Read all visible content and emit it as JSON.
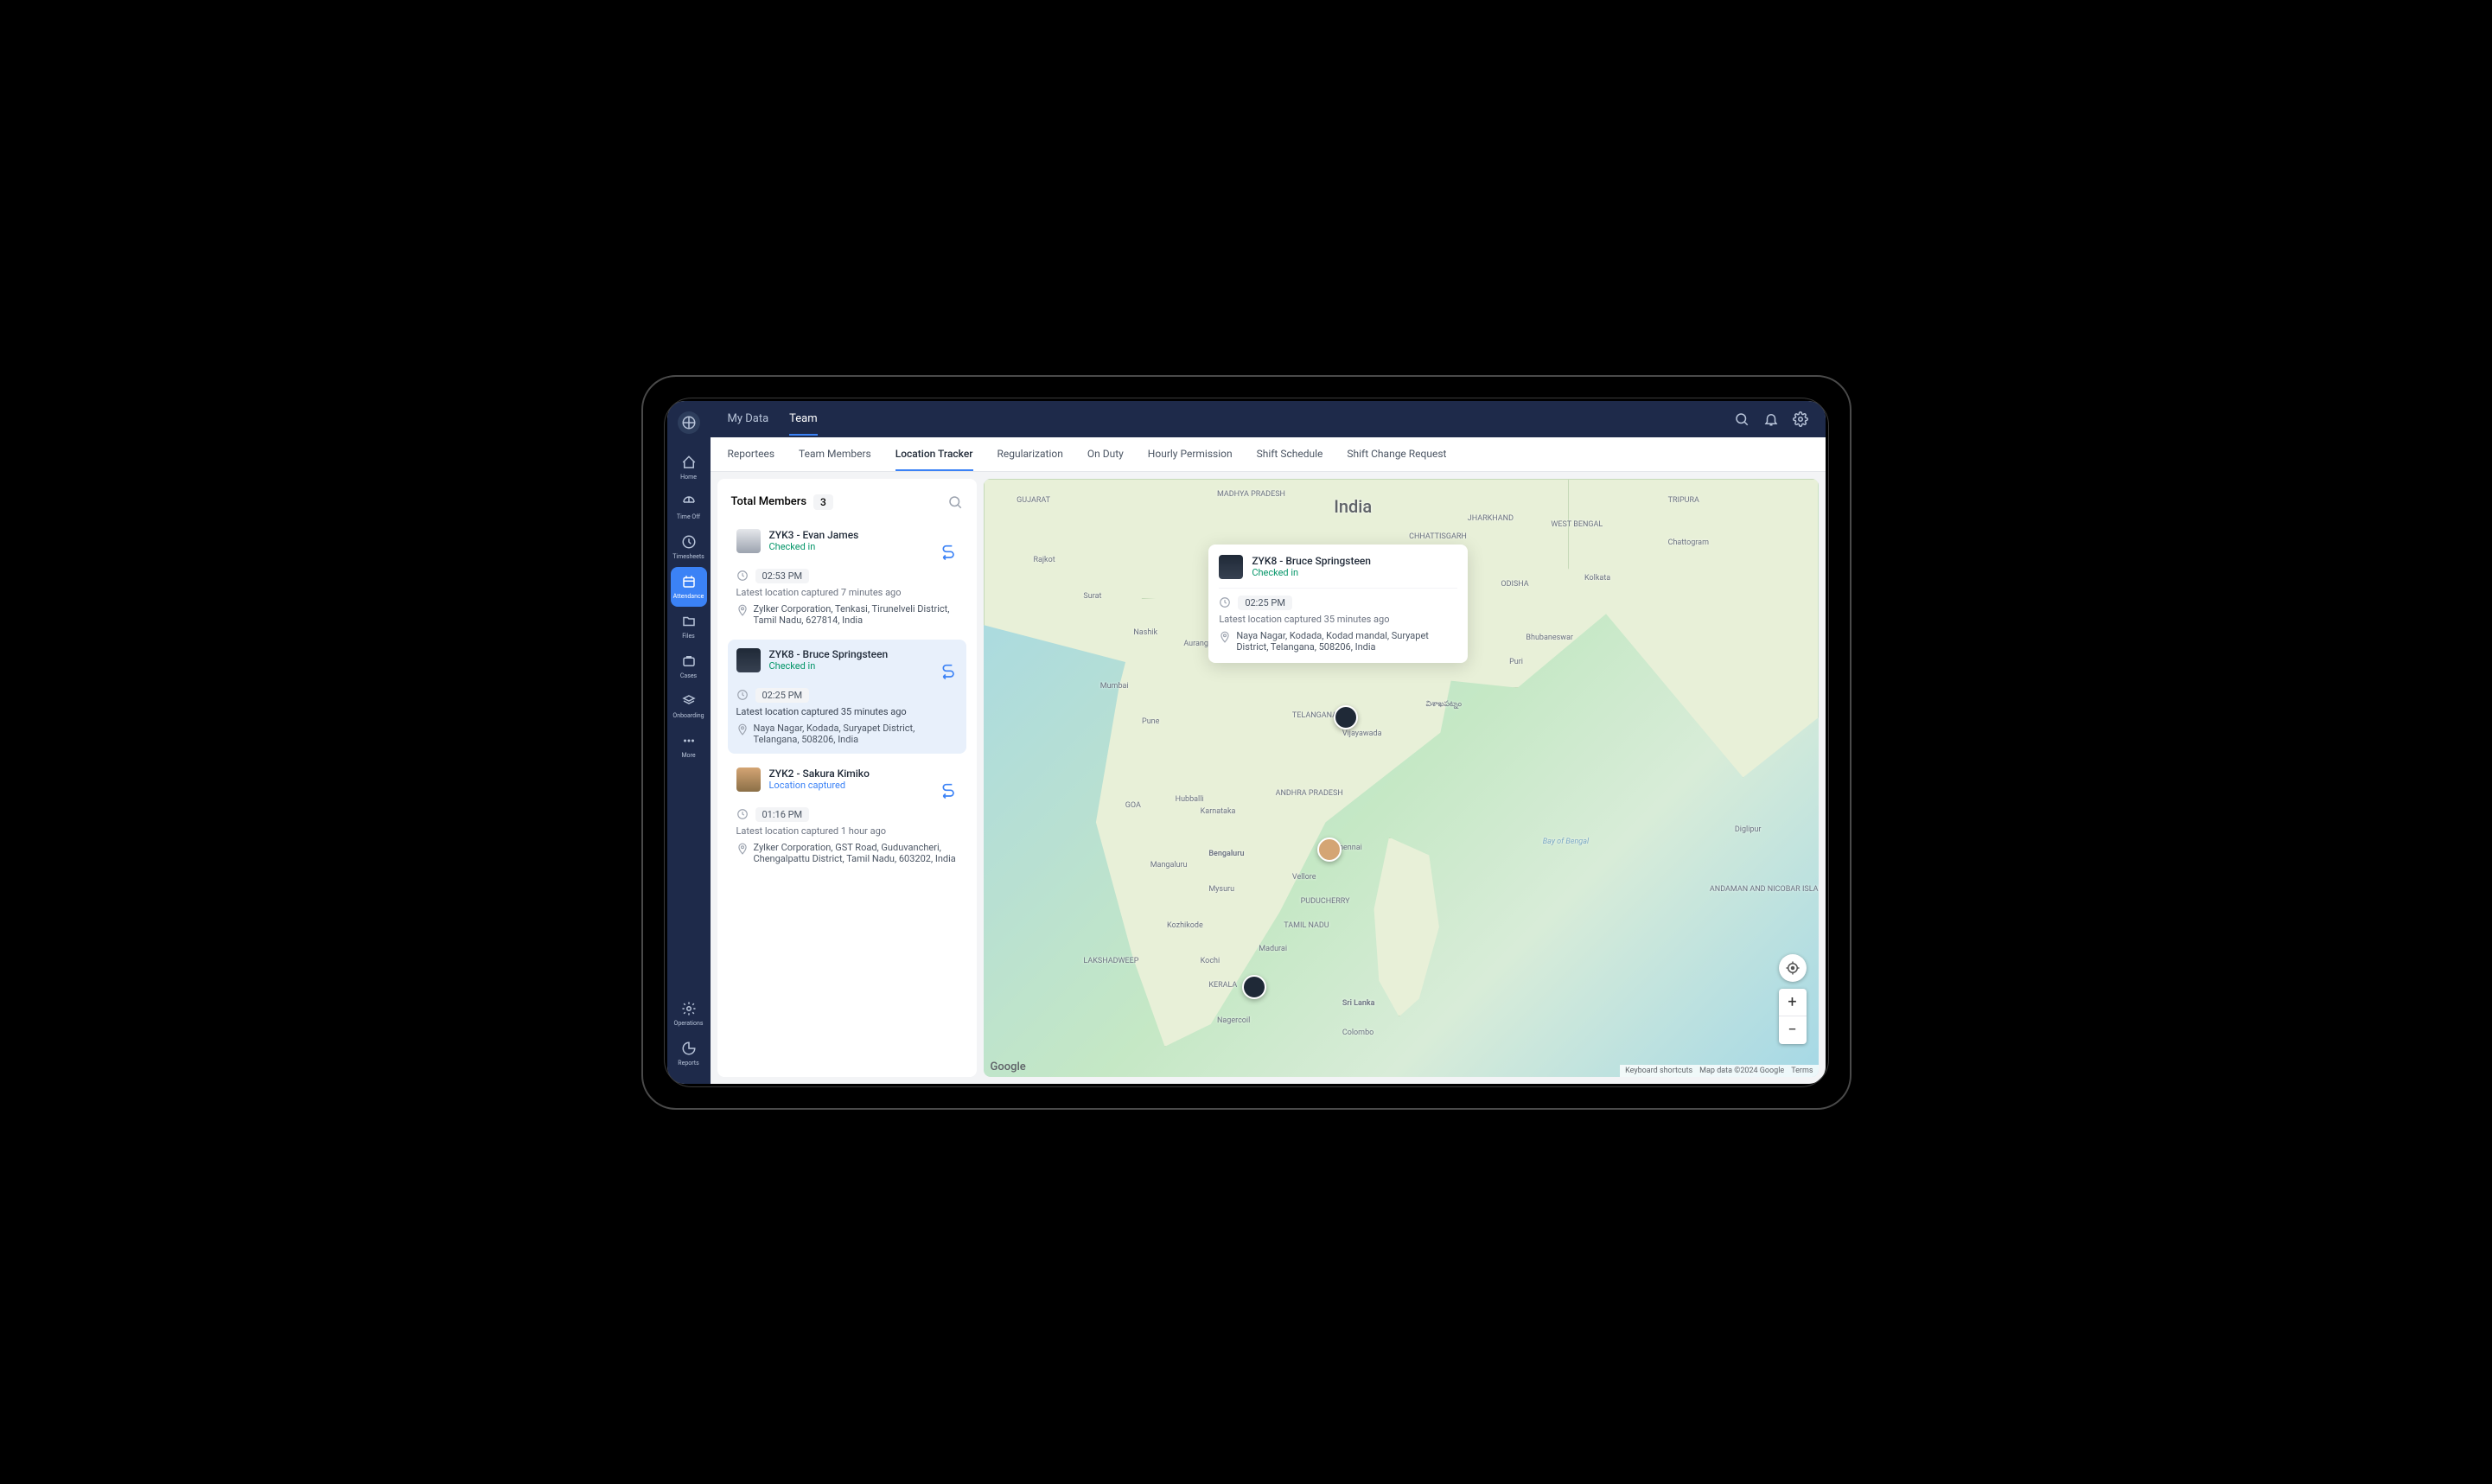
{
  "sidebar": {
    "items": [
      {
        "label": "Home"
      },
      {
        "label": "Time Off"
      },
      {
        "label": "Timesheets"
      },
      {
        "label": "Attendance"
      },
      {
        "label": "Files"
      },
      {
        "label": "Cases"
      },
      {
        "label": "Onboarding"
      },
      {
        "label": "More"
      }
    ],
    "bottom": [
      {
        "label": "Operations"
      },
      {
        "label": "Reports"
      }
    ]
  },
  "topbar": {
    "tabs": [
      "My Data",
      "Team"
    ]
  },
  "subtabs": [
    "Reportees",
    "Team Members",
    "Location Tracker",
    "Regularization",
    "On Duty",
    "Hourly Permission",
    "Shift Schedule",
    "Shift Change Request"
  ],
  "members_panel": {
    "title": "Total Members",
    "count": "3"
  },
  "members": [
    {
      "name": "ZYK3 - Evan James",
      "status": "Checked in",
      "status_type": "ok",
      "time": "02:53 PM",
      "latest": "Latest location captured 7 minutes ago",
      "address": "Zylker Corporation, Tenkasi, Tirunelveli District, Tamil Nadu, 627814, India"
    },
    {
      "name": "ZYK8 - Bruce Springsteen",
      "status": "Checked in",
      "status_type": "ok",
      "time": "02:25 PM",
      "latest": "Latest location captured 35 minutes ago",
      "address": "Naya Nagar, Kodada, Suryapet District, Telangana, 508206, India"
    },
    {
      "name": "ZYK2 - Sakura Kimiko",
      "status": "Location captured",
      "status_type": "captured",
      "time": "01:16 PM",
      "latest": "Latest location captured 1 hour ago",
      "address": "Zylker Corporation, GST Road, Guduvancheri, Chengalpattu District, Tamil Nadu, 603202, India"
    }
  ],
  "popup": {
    "name": "ZYK8 - Bruce Springsteen",
    "status": "Checked in",
    "time": "02:25 PM",
    "latest": "Latest location captured 35 minutes ago",
    "address": "Naya Nagar, Kodada, Kodad mandal, Suryapet District, Telangana, 508206, India"
  },
  "map": {
    "title": "India",
    "labels": {
      "gujarat": "GUJARAT",
      "mp": "MADHYA\nPRADESH",
      "rajkot": "Rajkot",
      "surat": "Surat",
      "nashik": "Nashik",
      "mumbai": "Mumbai",
      "pune": "Pune",
      "goa": "GOA",
      "karnataka": "Karnataka",
      "bengaluru": "Bengaluru",
      "mysuru": "Mysuru",
      "tn": "TAMIL NADU",
      "kochi": "Kochi",
      "madurai": "Madurai",
      "sl": "Sri Lanka",
      "colombo": "Colombo",
      "ap": "ANDHRA\nPRADESH",
      "telangana": "TELANGANA",
      "puducherry": "PUDUCHERRY",
      "wb": "WEST BENGAL",
      "kolkata": "Kolkata",
      "bhubaneswar": "Bhubaneswar",
      "odisha": "ODISHA",
      "tripura": "TRIPURA",
      "chattogram": "Chattogram",
      "andaman": "ANDAMAN\nAND NICOBAR\nISLANDS",
      "bob": "Bay of Bengal",
      "laksh": "LAKSHADWEEP",
      "jharkhand": "JHARKHAND",
      "vellore": "Vellore",
      "vijay": "Vijayawada",
      "chennai": "Chennai",
      "kozhikode": "Kozhikode",
      "kerala": "KERALA",
      "chhattis": "CHHATTISGARH",
      "hubballi": "Hubballi",
      "puri": "Puri",
      "mangaluru": "Mangaluru",
      "aurang": "Aurangabad",
      "nagercoil": "Nagercoil",
      "vishak": "విశాఖపట్నం",
      "diglipur": "Diglipur"
    },
    "footer": {
      "shortcuts": "Keyboard shortcuts",
      "mapdata": "Map data ©2024 Google",
      "terms": "Terms"
    },
    "google": "Google"
  }
}
